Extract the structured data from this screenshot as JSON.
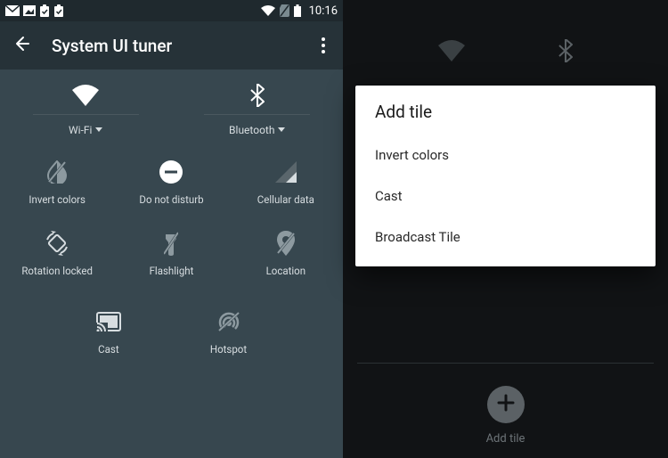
{
  "status": {
    "time": "10:16"
  },
  "appbar": {
    "title": "System UI tuner"
  },
  "top_tiles": {
    "wifi": "Wi-Fi",
    "bluetooth": "Bluetooth"
  },
  "tiles": {
    "invert": "Invert colors",
    "dnd": "Do not disturb",
    "cellular": "Cellular data",
    "rotation": "Rotation locked",
    "flashlight": "Flashlight",
    "location": "Location",
    "cast": "Cast",
    "hotspot": "Hotspot"
  },
  "dialog": {
    "title": "Add tile",
    "items": [
      "Invert colors",
      "Cast",
      "Broadcast Tile"
    ]
  },
  "right_bottom": {
    "add_label": "Add tile"
  }
}
